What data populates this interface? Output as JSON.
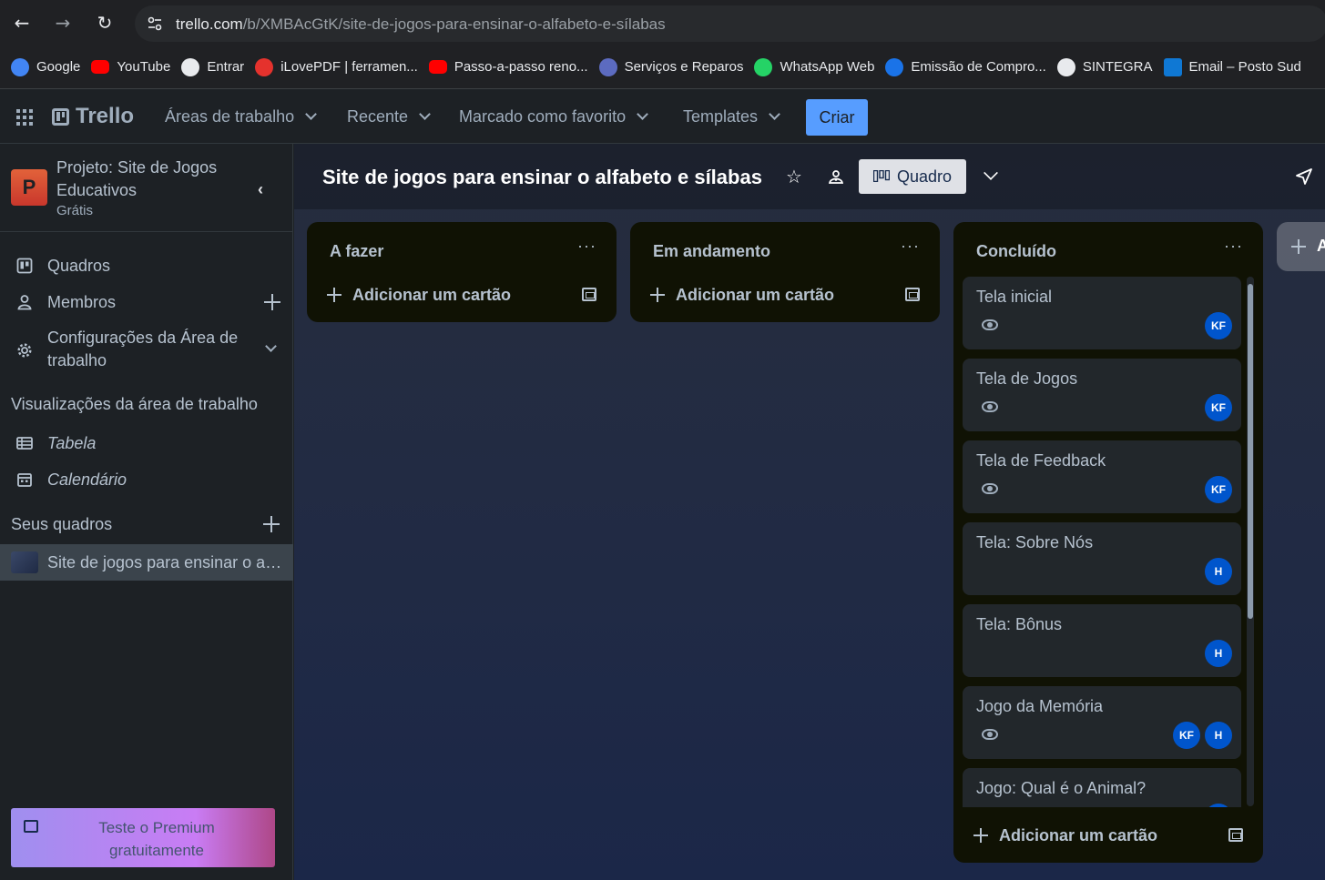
{
  "browser": {
    "url_host": "trello.com",
    "url_path": "/b/XMBAcGtK/site-de-jogos-para-ensinar-o-alfabeto-e-sílabas",
    "bookmarks": [
      {
        "label": "Google",
        "icon": "google-icon",
        "color": "#4285f4"
      },
      {
        "label": "YouTube",
        "icon": "youtube-icon",
        "color": "#ff0000"
      },
      {
        "label": "Entrar",
        "icon": "globe-icon",
        "color": "#e8eaed"
      },
      {
        "label": "iLovePDF | ferramen...",
        "icon": "ilovepdf-icon",
        "color": "#e5322d"
      },
      {
        "label": "Passo-a-passo reno...",
        "icon": "youtube-icon",
        "color": "#ff0000"
      },
      {
        "label": "Serviços e Reparos",
        "icon": "motorola-icon",
        "color": "#5c6bc0"
      },
      {
        "label": "WhatsApp Web",
        "icon": "whatsapp-icon",
        "color": "#25d366"
      },
      {
        "label": "Emissão de Compro...",
        "icon": "receita-icon",
        "color": "#1a73e8"
      },
      {
        "label": "SINTEGRA",
        "icon": "globe-icon",
        "color": "#e8eaed"
      },
      {
        "label": "Email – Posto Sud",
        "icon": "outlook-icon",
        "color": "#0f78d4"
      }
    ]
  },
  "header": {
    "logo": "Trello",
    "menu": [
      "Áreas de trabalho",
      "Recente",
      "Marcado como favorito",
      "Templates"
    ],
    "create_label": "Criar"
  },
  "sidebar": {
    "workspace_name": "Projeto:  Site de Jogos Educativos",
    "workspace_initial": "P",
    "workspace_plan": "Grátis",
    "items": [
      {
        "label": "Quadros",
        "icon": "board-icon"
      },
      {
        "label": "Membros",
        "icon": "person-icon"
      },
      {
        "label": "Configurações da Área de trabalho",
        "icon": "gear-icon"
      }
    ],
    "views_title": "Visualizações da área de trabalho",
    "views": [
      {
        "label": "Tabela",
        "icon": "table-icon"
      },
      {
        "label": "Calendário",
        "icon": "calendar-icon"
      }
    ],
    "boards_title": "Seus quadros",
    "boards": [
      "Site de jogos para ensinar o alfabeto e sílabas"
    ],
    "premium_label": "Teste o Premium gratuitamente"
  },
  "board": {
    "title": "Site de jogos para ensinar o alfabeto e sílabas",
    "view_label": "Quadro",
    "add_card_label": "Adicionar um cartão",
    "more_label": "···",
    "lists": [
      {
        "title": "A fazer",
        "cards": []
      },
      {
        "title": "Em andamento",
        "cards": []
      },
      {
        "title": "Concluído",
        "cards": [
          {
            "title": "Tela inicial",
            "watch": true,
            "members": [
              "KF"
            ]
          },
          {
            "title": "Tela de Jogos",
            "watch": true,
            "members": [
              "KF"
            ]
          },
          {
            "title": "Tela de Feedback",
            "watch": true,
            "members": [
              "KF"
            ]
          },
          {
            "title": "Tela: Sobre Nós",
            "watch": false,
            "members": [
              "H"
            ]
          },
          {
            "title": "Tela: Bônus",
            "watch": false,
            "members": [
              "H"
            ]
          },
          {
            "title": "Jogo da Memória",
            "watch": true,
            "members": [
              "KF",
              "H"
            ]
          },
          {
            "title": "Jogo: Qual é o Animal?",
            "watch": false,
            "members": [
              "H"
            ]
          }
        ]
      }
    ],
    "add_list_label": "A"
  }
}
